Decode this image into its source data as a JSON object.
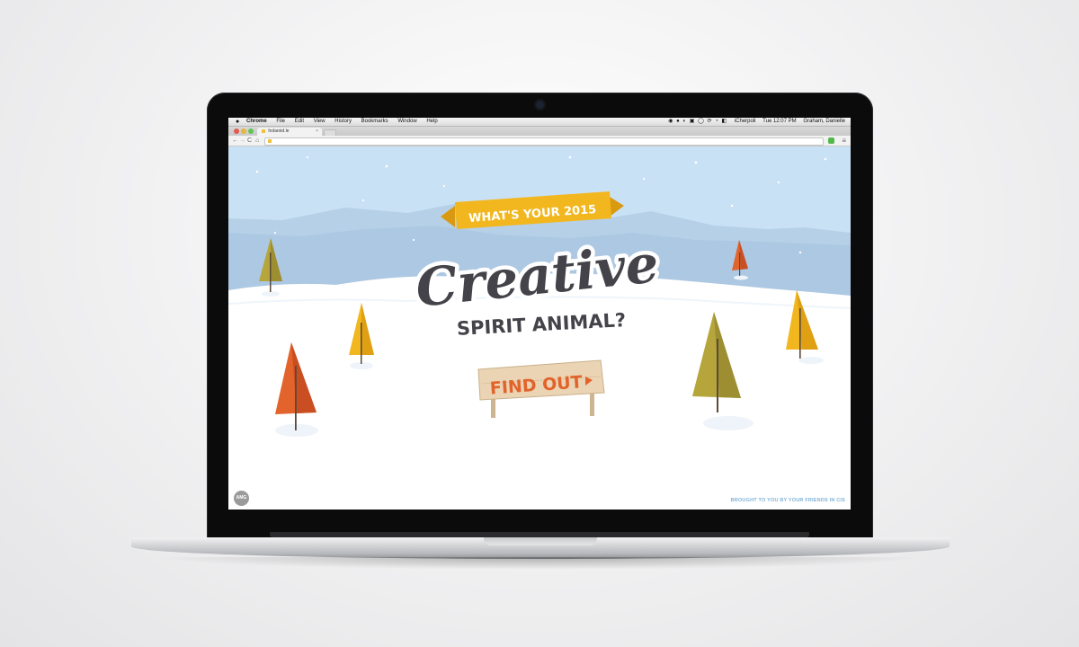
{
  "menubar": {
    "apple_icon": "apple-logo",
    "app_name": "Chrome",
    "menus": [
      "File",
      "Edit",
      "View",
      "History",
      "Bookmarks",
      "Window",
      "Help"
    ],
    "user_short": "iCherpoli",
    "clock": "Tue 12:07 PM",
    "user_name": "Graham, Danielle"
  },
  "browser": {
    "tab_title": "holaroid.le",
    "tab_close": "×",
    "nav": {
      "back": "←",
      "forward": "→",
      "reload": "C",
      "home": "⌂"
    },
    "menu_icon": "≡"
  },
  "page": {
    "banner_text": "WHAT'S YOUR 2015",
    "headline": "Creative",
    "subheadline": "SPIRIT ANIMAL?",
    "cta": "FIND OUT",
    "logo": "AMG",
    "credit": "BROUGHT TO YOU BY YOUR FRIENDS IN CIS"
  },
  "colors": {
    "sky": "#c9e1f4",
    "mountain": "#a9c7e1",
    "snow": "#ffffff",
    "banner": "#f2b71e",
    "headline": "#45434a",
    "cta_text": "#e2632b",
    "sign_wood": "#ead4b4",
    "tree_orange": "#e2632b",
    "tree_yellow": "#f2b71e",
    "tree_olive": "#b6a53b"
  }
}
